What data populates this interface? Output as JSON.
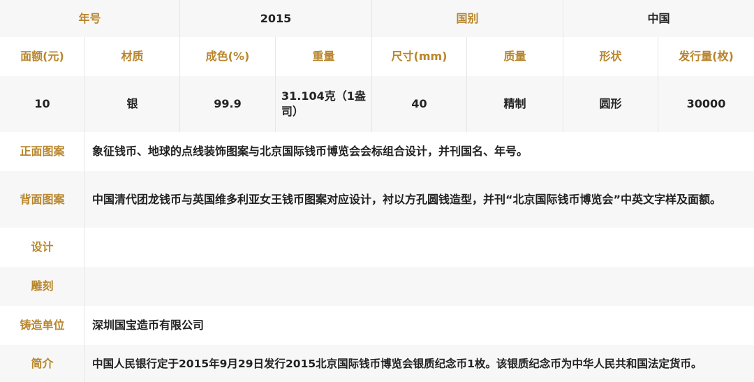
{
  "header": {
    "year_label": "年号",
    "year_value": "2015",
    "country_label": "国别",
    "country_value": "中国"
  },
  "columns": [
    "面额(元)",
    "材质",
    "成色(%)",
    "重量",
    "尺寸(mm)",
    "质量",
    "形状",
    "发行量(枚)"
  ],
  "values": [
    "10",
    "银",
    "99.9",
    "31.104克（1盎司）",
    "40",
    "精制",
    "圆形",
    "30000"
  ],
  "rows": {
    "obverse": {
      "label": "正面图案",
      "value": "象征钱币、地球的点线装饰图案与北京国际钱币博览会会标组合设计，并刊国名、年号。"
    },
    "reverse": {
      "label": "背面图案",
      "value": "中国清代团龙钱币与英国维多利亚女王钱币图案对应设计，衬以方孔圆钱造型，并刊“北京国际钱币博览会”中英文字样及面额。"
    },
    "design": {
      "label": "设计",
      "value": ""
    },
    "engraving": {
      "label": "雕刻",
      "value": ""
    },
    "mint": {
      "label": "铸造单位",
      "value": "深圳国宝造币有限公司"
    },
    "intro": {
      "label": "简介",
      "value": "中国人民银行定于2015年9月29日发行2015北京国际钱币博览会银质纪念币1枚。该银质纪念币为中华人民共和国法定货币。"
    }
  },
  "colors": {
    "label_gold": "#B8862C",
    "stripe": "#F7F7F7",
    "divider": "#E6E6E6"
  }
}
